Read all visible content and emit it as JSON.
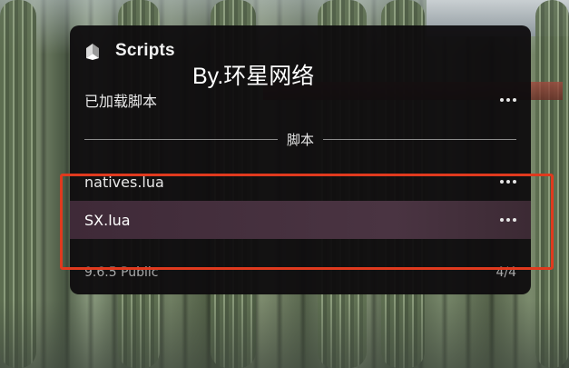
{
  "panel": {
    "title": "Scripts",
    "logo_icon": "scripts-logo-icon",
    "loaded_section_label": "已加载脚本",
    "divider_label": "脚本",
    "scripts": [
      {
        "label": "natives.lua"
      },
      {
        "label": "SX.lua",
        "selected": true
      }
    ],
    "footer": {
      "version": "9.6.5 Public",
      "count": "4/4"
    }
  },
  "overlay": {
    "watermark": "By.环星网络",
    "highlight_color": "#e03a1e"
  },
  "colors": {
    "panel_bg": "#0e0c0e",
    "selected_row": "#4a3442"
  }
}
